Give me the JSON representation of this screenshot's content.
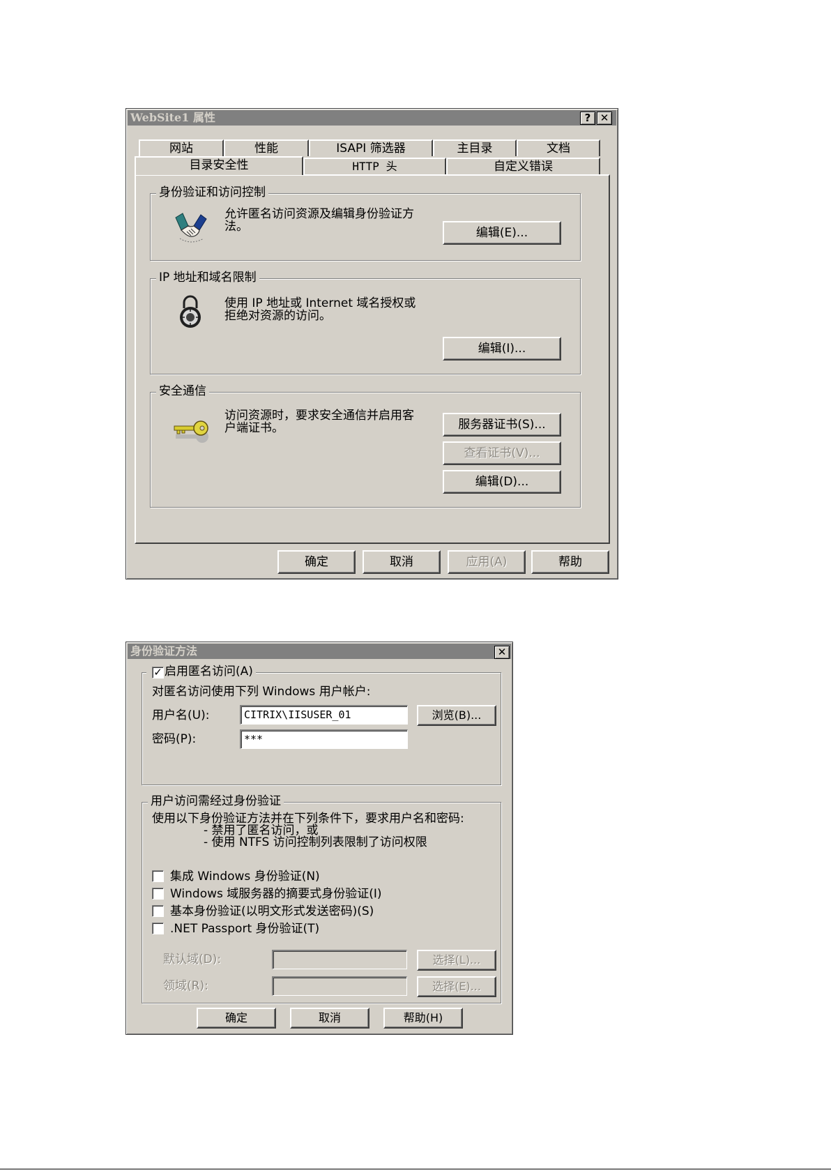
{
  "dialog1": {
    "title": "WebSite1 属性",
    "help_btn": "?",
    "close_btn": "✕",
    "tabs_row1": [
      "网站",
      "性能",
      "ISAPI 筛选器",
      "主目录",
      "文档"
    ],
    "tabs_row2": [
      "目录安全性",
      "HTTP 头",
      "自定义错误"
    ],
    "selected_tab": "目录安全性",
    "auth_group": {
      "title": "身份验证和访问控制",
      "desc_line1": "允许匿名访问资源及编辑身份验证方",
      "desc_line2": "法。",
      "edit_btn": "编辑(E)...",
      "icon": "handshake-icon"
    },
    "ip_group": {
      "title": "IP 地址和域名限制",
      "desc_line1": "使用 IP 地址或 Internet 域名授权或",
      "desc_line2": "拒绝对资源的访问。",
      "edit_btn": "编辑(I)...",
      "icon": "padlock-icon"
    },
    "secure_group": {
      "title": "安全通信",
      "desc_line1": "访问资源时，要求安全通信并启用客",
      "desc_line2": "户端证书。",
      "server_cert_btn": "服务器证书(S)...",
      "view_cert_btn": "查看证书(V)...",
      "edit_btn": "编辑(D)...",
      "icon": "key-icon"
    },
    "footer": {
      "ok": "确定",
      "cancel": "取消",
      "apply": "应用(A)",
      "help": "帮助"
    }
  },
  "dialog2": {
    "title": "身份验证方法",
    "close_btn": "✕",
    "anon_group": {
      "checkbox_label": "启用匿名访问(A)",
      "checked": true,
      "desc": "对匿名访问使用下列 Windows 用户帐户:",
      "username_label": "用户名(U):",
      "username_value": "CITRIX\\IISUSER_01",
      "password_label": "密码(P):",
      "password_value": "***",
      "browse_btn": "浏览(B)..."
    },
    "auth_group": {
      "title": "用户访问需经过身份验证",
      "desc_line1": "使用以下身份验证方法并在下列条件下，要求用户名和密码:",
      "desc_line2": "- 禁用了匿名访问，或",
      "desc_line3": "- 使用 NTFS 访问控制列表限制了访问权限",
      "options": [
        "集成 Windows 身份验证(N)",
        "Windows 域服务器的摘要式身份验证(I)",
        "基本身份验证(以明文形式发送密码)(S)",
        ".NET Passport 身份验证(T)"
      ],
      "default_domain_label": "默认域(D):",
      "realm_label": "领域(R):",
      "select_btn1": "选择(L)...",
      "select_btn2": "选择(E)..."
    },
    "footer": {
      "ok": "确定",
      "cancel": "取消",
      "help": "帮助(H)"
    }
  }
}
